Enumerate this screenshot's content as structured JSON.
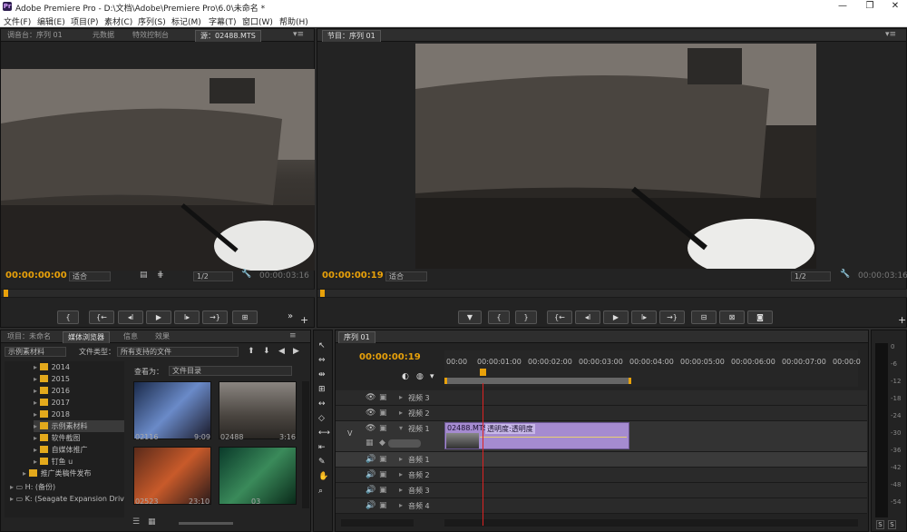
{
  "app": {
    "title": "Adobe Premiere Pro - D:\\文档\\Adobe\\Premiere Pro\\6.0\\未命名 *",
    "logo": "Pr"
  },
  "menu": [
    "文件(F)",
    "编辑(E)",
    "项目(P)",
    "素材(C)",
    "序列(S)",
    "标记(M)",
    "字幕(T)",
    "窗口(W)",
    "帮助(H)"
  ],
  "source_panel": {
    "tabs": [
      "调音台：序列 01",
      "元数据",
      "特效控制台",
      "源：02488.MTS"
    ],
    "tc_in": "00:00:00:00",
    "fit": "适合",
    "res": "1/2",
    "tc_out": "00:00:03:16"
  },
  "program_panel": {
    "tabs": [
      "节目：序列 01"
    ],
    "tc_in": "00:00:00:19",
    "fit": "适合",
    "res": "1/2",
    "tc_out": "00:00:03:16"
  },
  "project_panel": {
    "tabs": [
      "项目：未命名",
      "媒体浏览器",
      "信息",
      "效果"
    ],
    "location": "示例素材料",
    "filetype_label": "文件类型：",
    "filetype_value": "所有支持的文件",
    "view_label": "查看为：",
    "view_value": "文件目录",
    "tree": [
      "2014",
      "2015",
      "2016",
      "2017",
      "2018",
      "示例素材料",
      "软件截图",
      "自媒体推广",
      "钉鱼 u",
      "推广类稿件发布",
      "H: (备份)",
      "K: (Seagate Expansion Driv"
    ],
    "thumbs": [
      {
        "name": "02116",
        "dur": "9:09"
      },
      {
        "name": "02488",
        "dur": "3:16"
      },
      {
        "name": "02523",
        "dur": "23:10"
      },
      {
        "name": "03",
        "dur": ""
      }
    ]
  },
  "timeline": {
    "tab": "序列 01",
    "tc": "00:00:00:19",
    "ruler": [
      "00:00",
      "00:00:01:00",
      "00:00:02:00",
      "00:00:03:00",
      "00:00:04:00",
      "00:00:05:00",
      "00:00:06:00",
      "00:00:07:00",
      "00:00:0"
    ],
    "video_tracks": [
      "视频 3",
      "视频 2",
      "视频 1"
    ],
    "audio_tracks": [
      "音频 1",
      "音频 2",
      "音频 3",
      "音频 4"
    ],
    "v_label": "V",
    "clip_name": "02488.MTS",
    "clip_fx": "透明度:透明度"
  },
  "meter": {
    "ticks": [
      "0",
      "-6",
      "-12",
      "-18",
      "-24",
      "-30",
      "-36",
      "-42",
      "-48",
      "-54"
    ],
    "solo": [
      "S",
      "S"
    ]
  },
  "colors": {
    "accent": "#e8a10a",
    "clip": "#a58bd0",
    "playhead": "#d22"
  }
}
